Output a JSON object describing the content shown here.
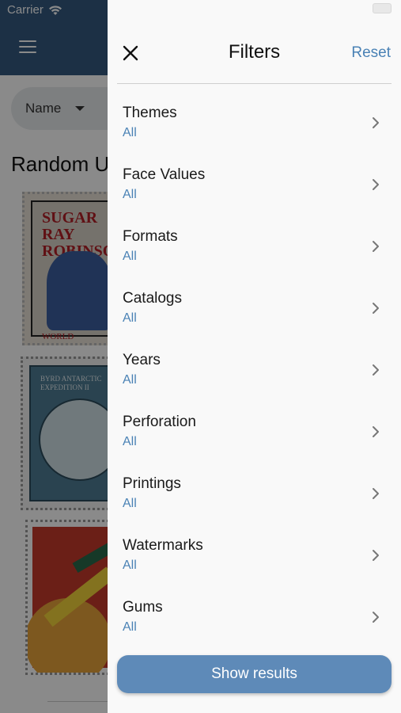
{
  "status_bar": {
    "carrier": "Carrier",
    "time": ""
  },
  "background": {
    "name_select_value": "Name",
    "section_title": "Random U",
    "stamp1_text": "SUGAR RAY ROBINSON",
    "stamp1_footer": "WORLD CHAMPIO",
    "stamp2_text": "BYRD ANTARCTIC EXPEDITION II"
  },
  "drawer": {
    "title": "Filters",
    "reset_label": "Reset",
    "filters": [
      {
        "label": "Themes",
        "value": "All"
      },
      {
        "label": "Face Values",
        "value": "All"
      },
      {
        "label": "Formats",
        "value": "All"
      },
      {
        "label": "Catalogs",
        "value": "All"
      },
      {
        "label": "Years",
        "value": "All"
      },
      {
        "label": "Perforation",
        "value": "All"
      },
      {
        "label": "Printings",
        "value": "All"
      },
      {
        "label": "Watermarks",
        "value": "All"
      },
      {
        "label": "Gums",
        "value": "All"
      }
    ],
    "show_results_label": "Show results"
  },
  "colors": {
    "accent": "#4a82b5",
    "button": "#5e8ab8",
    "header": "#345a80"
  }
}
